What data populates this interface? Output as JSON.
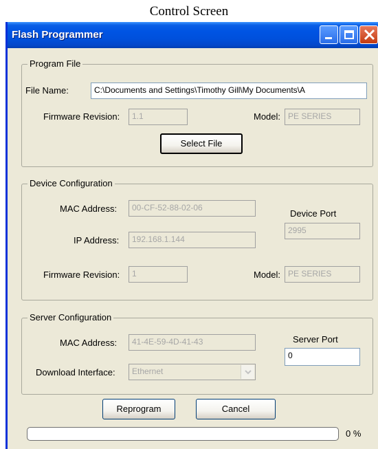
{
  "caption": "Control Screen",
  "window": {
    "title": "Flash Programmer",
    "controls": [
      "minimize-icon",
      "maximize-icon",
      "close-icon"
    ]
  },
  "program_file": {
    "legend": "Program File",
    "file_name_label": "File Name:",
    "file_name_value": "C:\\Documents and Settings\\Timothy Gill\\My Documents\\A",
    "firmware_label": "Firmware Revision:",
    "firmware_value": "1.1",
    "model_label": "Model:",
    "model_value": "PE SERIES",
    "select_button": "Select File"
  },
  "device_config": {
    "legend": "Device Configuration",
    "mac_label": "MAC Address:",
    "mac_value": "00-CF-52-88-02-06",
    "ip_label": "IP Address:",
    "ip_value": "192.168.1.144",
    "port_label": "Device Port",
    "port_value": "2995",
    "firmware_label": "Firmware Revision:",
    "firmware_value": "1",
    "model_label": "Model:",
    "model_value": "PE SERIES"
  },
  "server_config": {
    "legend": "Server Configuration",
    "mac_label": "MAC Address:",
    "mac_value": "41-4E-59-4D-41-43",
    "port_label": "Server Port",
    "port_value": "0",
    "interface_label": "Download Interface:",
    "interface_value": "Ethernet"
  },
  "actions": {
    "reprogram": "Reprogram",
    "cancel": "Cancel"
  },
  "progress": {
    "value": 0,
    "label": "0 %"
  },
  "colors": {
    "titlebar": "#0054e3",
    "window_bg": "#ece9d8",
    "disabled_text": "#a6a6a6"
  }
}
